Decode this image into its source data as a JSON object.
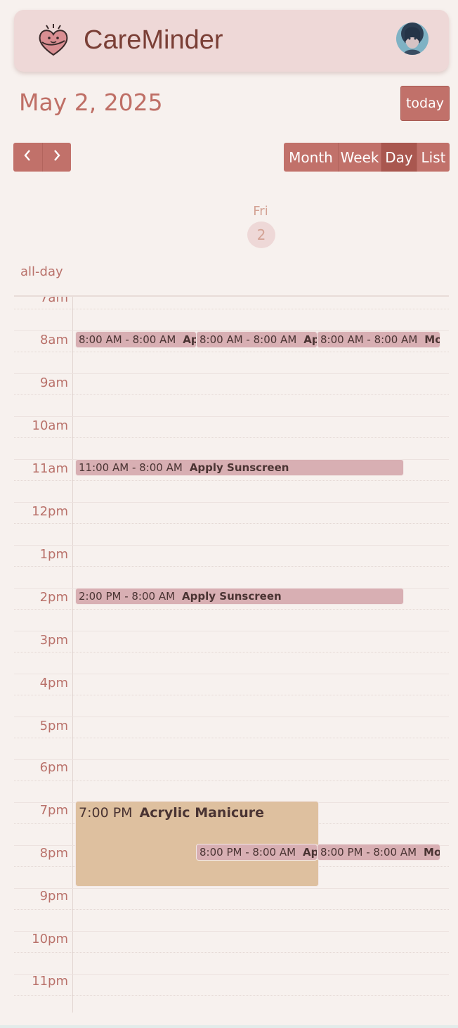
{
  "header": {
    "app_title": "CareMinder",
    "logo_icon": "heart-hug-logo-icon",
    "avatar_icon": "user-avatar-icon"
  },
  "toolbar": {
    "date_title": "May 2, 2025",
    "today_label": "today",
    "prev_icon": "chevron-left-icon",
    "next_icon": "chevron-right-icon",
    "views": [
      "Month",
      "Week",
      "Day",
      "List"
    ],
    "active_view": "Day"
  },
  "day_header": {
    "day_name": "Fri",
    "day_number": "2"
  },
  "allday_label": "all-day",
  "hours": [
    "7am",
    "8am",
    "9am",
    "10am",
    "11am",
    "12pm",
    "1pm",
    "2pm",
    "3pm",
    "4pm",
    "5pm",
    "6pm",
    "7pm",
    "8pm",
    "9pm",
    "10pm",
    "11pm"
  ],
  "events": [
    {
      "time": "8:00 AM - 8:00 AM",
      "title": "Apply Sunscreen"
    },
    {
      "time": "8:00 AM - 8:00 AM",
      "title": "Apply Sunscreen"
    },
    {
      "time": "8:00 AM - 8:00 AM",
      "title": "Moisturize"
    },
    {
      "time": "11:00 AM - 8:00 AM",
      "title": "Apply Sunscreen"
    },
    {
      "time": "2:00 PM - 8:00 AM",
      "title": "Apply Sunscreen"
    },
    {
      "time": "7:00 PM",
      "title": "Acrylic Manicure"
    },
    {
      "time": "8:00 PM - 8:00 AM",
      "title": "Apply Sunscreen"
    },
    {
      "time": "8:00 PM - 8:00 AM",
      "title": "Moisturize"
    }
  ],
  "colors": {
    "accent": "#c1716a",
    "accent_active": "#a9574f",
    "event_pink": "#d8afb3",
    "event_tan": "#dec09f",
    "background": "#f7f1ee",
    "header_bg": "#eed8d7"
  }
}
